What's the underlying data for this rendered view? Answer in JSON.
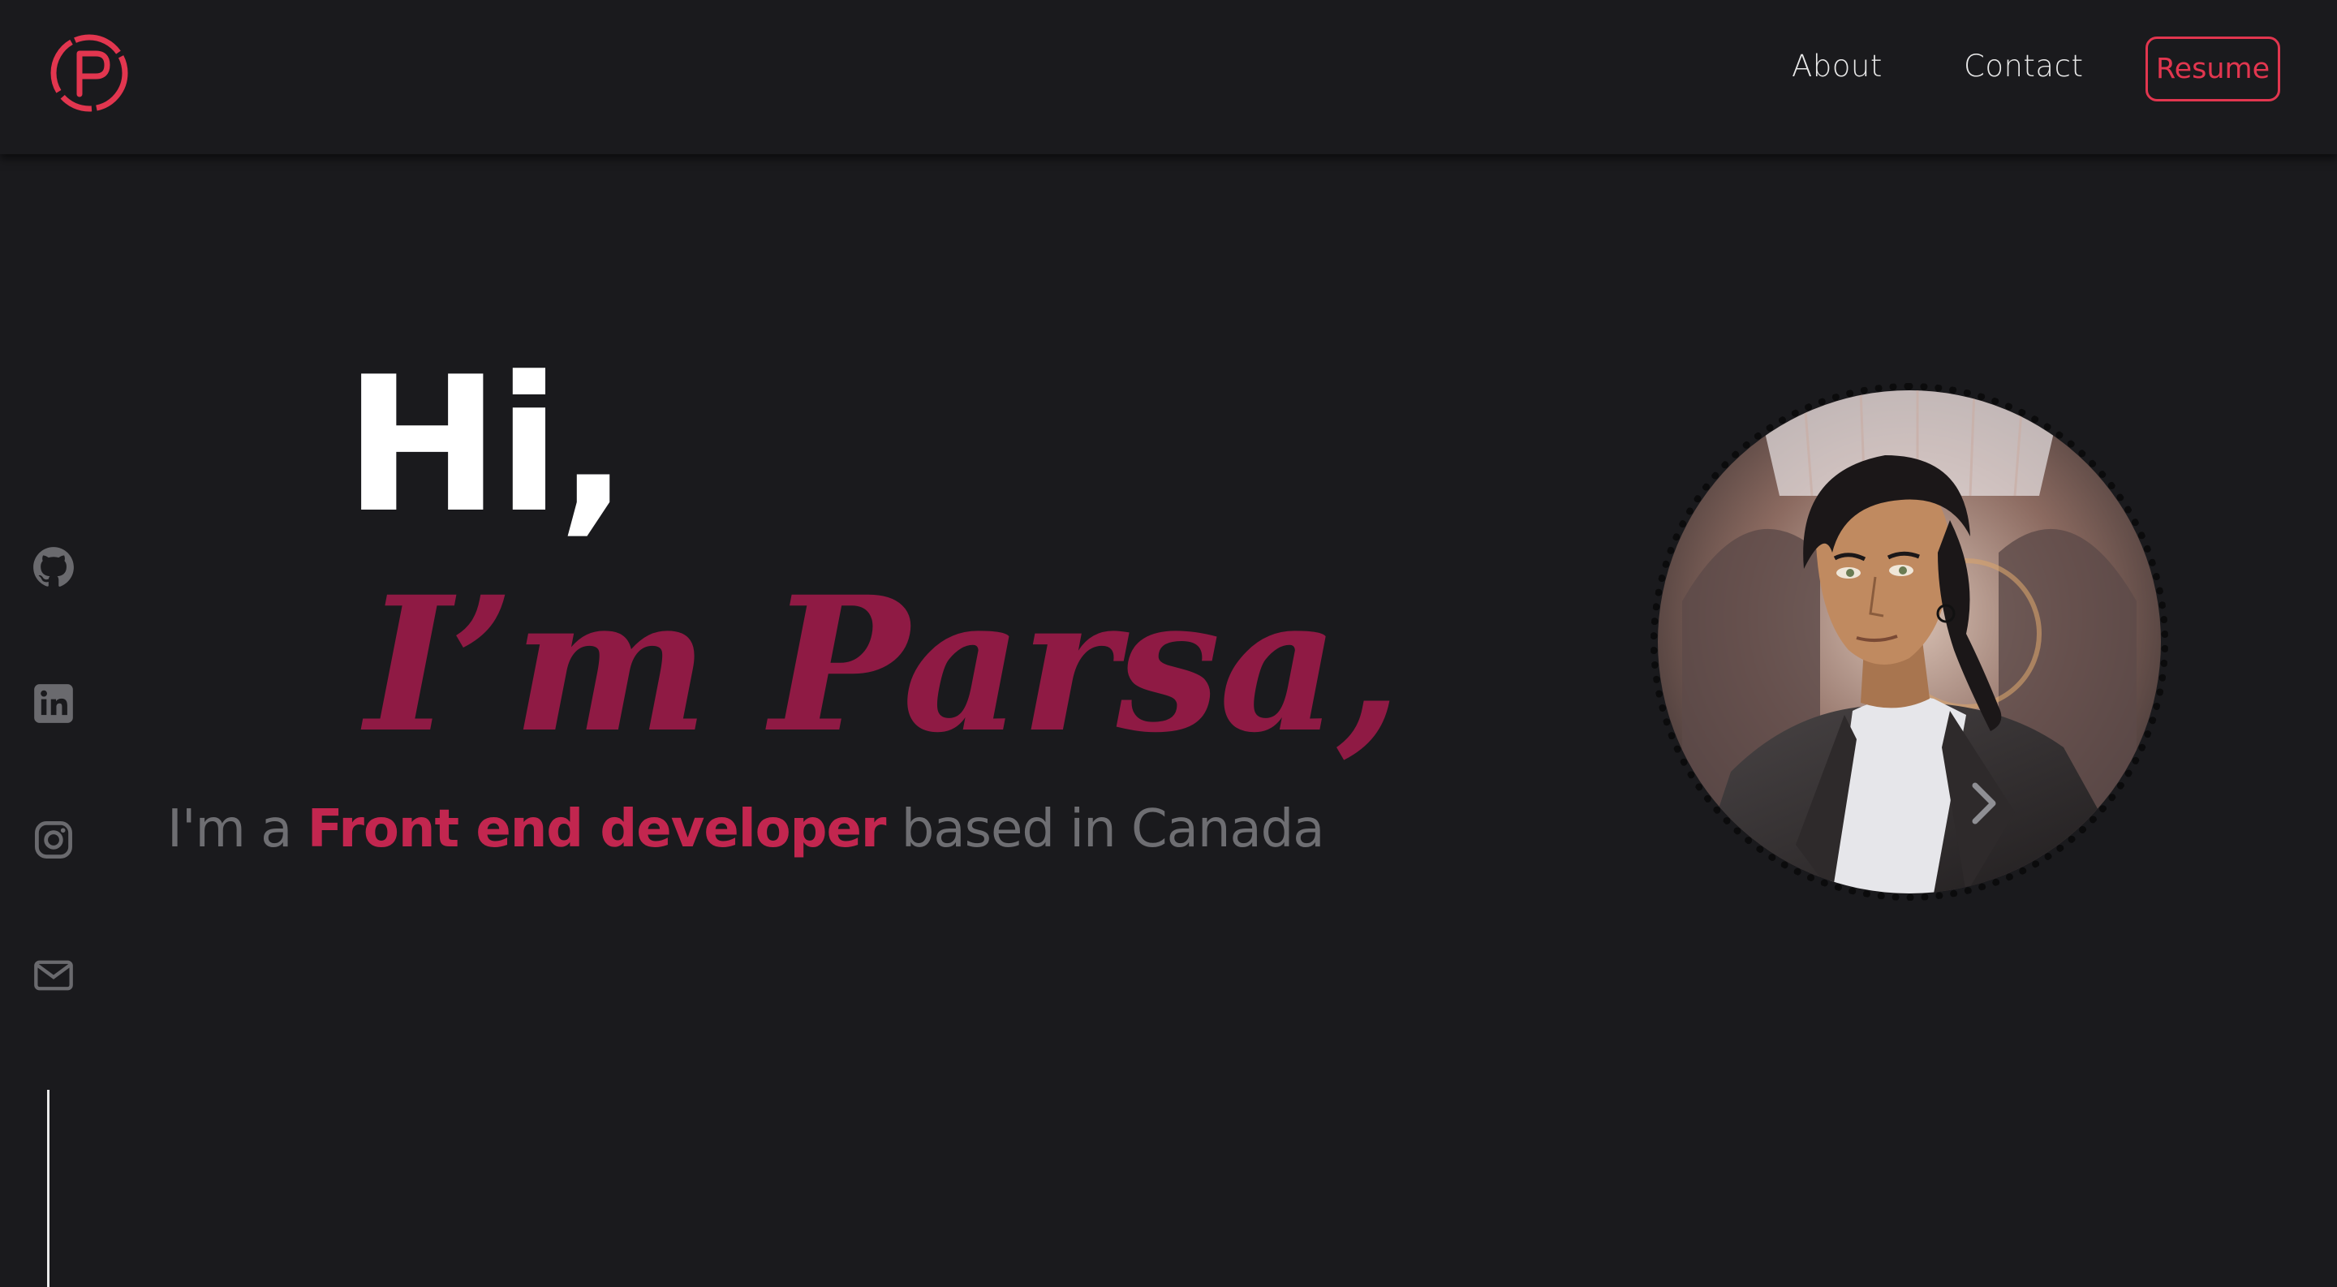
{
  "header": {
    "logo_icon": "p-logo-icon",
    "nav": {
      "about_label": "About",
      "contact_label": "Contact",
      "resume_label": "Resume"
    }
  },
  "social": [
    {
      "name": "github",
      "icon": "github-icon"
    },
    {
      "name": "linkedin",
      "icon": "linkedin-icon"
    },
    {
      "name": "instagram",
      "icon": "instagram-icon"
    },
    {
      "name": "email",
      "icon": "mail-icon"
    }
  ],
  "hero": {
    "greeting": "Hi,",
    "name_line": "I’m Parsa,",
    "sub_prefix": "I'm a ",
    "sub_role": "Front end developer",
    "sub_suffix": " based in Canada"
  },
  "avatar": {
    "icon": "avatar-illustration",
    "next_icon": "chevron-right-icon"
  },
  "colors": {
    "background": "#1a1a1d",
    "accent": "#e2364f",
    "name": "#8f1a44",
    "role": "#c2264f",
    "muted": "#6e6e72"
  }
}
